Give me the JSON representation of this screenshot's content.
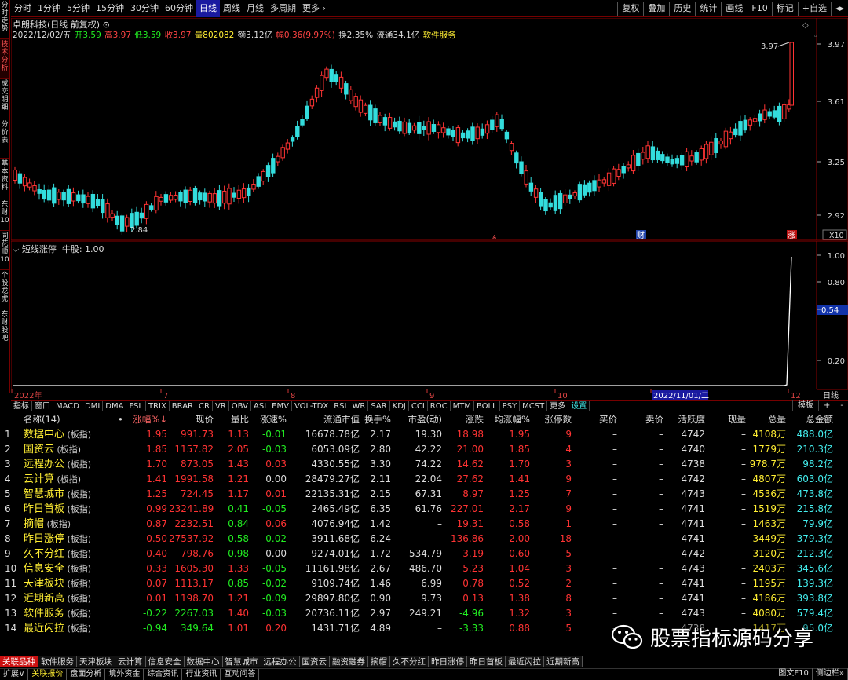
{
  "left_tabs": [
    "分时走势",
    "技术分析",
    "成交明细",
    "分价表",
    "基本资料",
    "东财10",
    "同花顺10",
    "个股龙虎",
    "东财股吧"
  ],
  "left_tab_active": 1,
  "periods": [
    "分时",
    "1分钟",
    "5分钟",
    "15分钟",
    "30分钟",
    "60分钟",
    "日线",
    "周线",
    "月线",
    "多周期",
    "更多 ›"
  ],
  "period_active": 6,
  "right_buttons": [
    "复权",
    "叠加",
    "历史",
    "统计",
    "画线",
    "F10",
    "标记",
    "+自选",
    "◂▸"
  ],
  "info_title": "卓朗科技(日线 前复权) ⊙",
  "info_fields": [
    {
      "text": "2022/12/02/五",
      "cls": "w"
    },
    {
      "text": "开3.59",
      "cls": "g"
    },
    {
      "text": "高3.97",
      "cls": "r"
    },
    {
      "text": "低3.59",
      "cls": "g"
    },
    {
      "text": "收3.97",
      "cls": "r"
    },
    {
      "text": "量802082",
      "cls": "y"
    },
    {
      "text": "额3.12亿",
      "cls": "w"
    },
    {
      "text": "幅0.36(9.97%)",
      "cls": "r"
    },
    {
      "text": "换2.35%",
      "cls": "w"
    },
    {
      "text": "流通34.1亿",
      "cls": "w"
    },
    {
      "text": "软件服务",
      "cls": "y"
    }
  ],
  "main_axis_labels": [
    "3.97",
    "3.61",
    "3.25",
    "2.92"
  ],
  "hi_label": "3.97",
  "lo_label": "2.84",
  "x10_label": "X10",
  "markers": {
    "cai": "财",
    "zhang": "涨"
  },
  "indicator_info": {
    "name": "短线涨停",
    "value": "牛股: 1.00"
  },
  "ind_axis_labels": [
    "1.00",
    "0.80",
    "0.54",
    "0.20"
  ],
  "date_labels": [
    "2022年",
    "7",
    "8",
    "9",
    "10",
    "2022/11/01/二",
    "12"
  ],
  "period_short": "日线",
  "indicator_tabs": [
    "指标",
    "窗口",
    "MACD",
    "DMI",
    "DMA",
    "FSL",
    "TRIX",
    "BRAR",
    "CR",
    "VR",
    "OBV",
    "ASI",
    "EMV",
    "VOL-TDX",
    "RSI",
    "WR",
    "SAR",
    "KDJ",
    "CCI",
    "ROC",
    "MTM",
    "BOLL",
    "PSY",
    "MCST",
    "更多",
    "设置"
  ],
  "indicator_tabs_right": [
    "模板",
    "+",
    "-"
  ],
  "table_header": [
    "名称(14)",
    "•",
    "涨幅%↓",
    "现价",
    "量比",
    "涨速%",
    "流通市值",
    "换手%",
    "市盈(动)",
    "涨跌",
    "均涨幅%",
    "涨停数",
    "买价",
    "卖价",
    "活跃度",
    "现量",
    "总量",
    "总金额"
  ],
  "table_rows": [
    {
      "i": "1",
      "name": "数据中心",
      "tag": "(板指)",
      "chg": "1.95",
      "price": "991.73",
      "vr": "1.13",
      "spd": "-0.01",
      "mcap": "16678.78亿",
      "turn": "2.17",
      "pe": "19.30",
      "diff": "18.98",
      "avg": "1.95",
      "lim": "9",
      "bid": "–",
      "ask": "–",
      "act": "4742",
      "cur": "–",
      "vol": "4108万",
      "amt": "488.0亿"
    },
    {
      "i": "2",
      "name": "国资云",
      "tag": "(板指)",
      "chg": "1.85",
      "price": "1157.82",
      "vr": "2.05",
      "spd": "-0.03",
      "mcap": "6053.09亿",
      "turn": "2.80",
      "pe": "42.22",
      "diff": "21.00",
      "avg": "1.85",
      "lim": "4",
      "bid": "–",
      "ask": "–",
      "act": "4740",
      "cur": "–",
      "vol": "1779万",
      "amt": "210.3亿"
    },
    {
      "i": "3",
      "name": "远程办公",
      "tag": "(板指)",
      "chg": "1.70",
      "price": "873.05",
      "vr": "1.43",
      "spd": "0.03",
      "mcap": "4330.55亿",
      "turn": "3.30",
      "pe": "74.22",
      "diff": "14.62",
      "avg": "1.70",
      "lim": "3",
      "bid": "–",
      "ask": "–",
      "act": "4738",
      "cur": "–",
      "vol": "978.7万",
      "amt": "98.2亿"
    },
    {
      "i": "4",
      "name": "云计算",
      "tag": "(板指)",
      "chg": "1.41",
      "price": "1991.58",
      "vr": "1.21",
      "spd": "0.00",
      "mcap": "28479.27亿",
      "turn": "2.11",
      "pe": "22.04",
      "diff": "27.62",
      "avg": "1.41",
      "lim": "9",
      "bid": "–",
      "ask": "–",
      "act": "4742",
      "cur": "–",
      "vol": "4807万",
      "amt": "603.0亿"
    },
    {
      "i": "5",
      "name": "智慧城市",
      "tag": "(板指)",
      "chg": "1.25",
      "price": "724.45",
      "vr": "1.17",
      "spd": "0.01",
      "mcap": "22135.31亿",
      "turn": "2.15",
      "pe": "67.31",
      "diff": "8.97",
      "avg": "1.25",
      "lim": "7",
      "bid": "–",
      "ask": "–",
      "act": "4743",
      "cur": "–",
      "vol": "4536万",
      "amt": "473.8亿"
    },
    {
      "i": "6",
      "name": "昨日首板",
      "tag": "(板指)",
      "chg": "0.99",
      "price": "23241.89",
      "vr": "0.41",
      "spd": "-0.05",
      "mcap": "2465.49亿",
      "turn": "6.35",
      "pe": "61.76",
      "diff": "227.01",
      "avg": "2.17",
      "lim": "9",
      "bid": "–",
      "ask": "–",
      "act": "4741",
      "cur": "–",
      "vol": "1519万",
      "amt": "215.8亿"
    },
    {
      "i": "7",
      "name": "摘帽",
      "tag": "(板指)",
      "chg": "0.87",
      "price": "2232.51",
      "vr": "0.84",
      "spd": "0.06",
      "mcap": "4076.94亿",
      "turn": "1.42",
      "pe": "–",
      "diff": "19.31",
      "avg": "0.58",
      "lim": "1",
      "bid": "–",
      "ask": "–",
      "act": "4741",
      "cur": "–",
      "vol": "1463万",
      "amt": "79.9亿"
    },
    {
      "i": "8",
      "name": "昨日涨停",
      "tag": "(板指)",
      "chg": "0.50",
      "price": "27537.92",
      "vr": "0.58",
      "spd": "-0.02",
      "mcap": "3911.68亿",
      "turn": "6.24",
      "pe": "–",
      "diff": "136.86",
      "avg": "2.00",
      "lim": "18",
      "bid": "–",
      "ask": "–",
      "act": "4741",
      "cur": "–",
      "vol": "3449万",
      "amt": "379.3亿"
    },
    {
      "i": "9",
      "name": "久不分红",
      "tag": "(板指)",
      "chg": "0.40",
      "price": "798.76",
      "vr": "0.98",
      "spd": "0.00",
      "mcap": "9274.01亿",
      "turn": "1.72",
      "pe": "534.79",
      "diff": "3.19",
      "avg": "0.60",
      "lim": "5",
      "bid": "–",
      "ask": "–",
      "act": "4742",
      "cur": "–",
      "vol": "3120万",
      "amt": "212.3亿"
    },
    {
      "i": "10",
      "name": "信息安全",
      "tag": "(板指)",
      "chg": "0.33",
      "price": "1605.30",
      "vr": "1.33",
      "spd": "-0.05",
      "mcap": "11161.98亿",
      "turn": "2.67",
      "pe": "486.70",
      "diff": "5.23",
      "avg": "1.04",
      "lim": "3",
      "bid": "–",
      "ask": "–",
      "act": "4743",
      "cur": "–",
      "vol": "2403万",
      "amt": "345.6亿"
    },
    {
      "i": "11",
      "name": "天津板块",
      "tag": "(板指)",
      "chg": "0.07",
      "price": "1113.17",
      "vr": "0.85",
      "spd": "-0.02",
      "mcap": "9109.74亿",
      "turn": "1.46",
      "pe": "6.99",
      "diff": "0.78",
      "avg": "0.52",
      "lim": "2",
      "bid": "–",
      "ask": "–",
      "act": "4741",
      "cur": "–",
      "vol": "1195万",
      "amt": "139.3亿"
    },
    {
      "i": "12",
      "name": "近期新高",
      "tag": "(板指)",
      "chg": "0.01",
      "price": "1198.70",
      "vr": "1.21",
      "spd": "-0.09",
      "mcap": "29897.80亿",
      "turn": "0.90",
      "pe": "9.73",
      "diff": "0.13",
      "avg": "1.38",
      "lim": "8",
      "bid": "–",
      "ask": "–",
      "act": "4741",
      "cur": "–",
      "vol": "4186万",
      "amt": "393.8亿"
    },
    {
      "i": "13",
      "name": "软件服务",
      "tag": "(板指)",
      "chg": "-0.22",
      "price": "2267.03",
      "vr": "1.40",
      "spd": "-0.03",
      "mcap": "20736.11亿",
      "turn": "2.97",
      "pe": "249.21",
      "diff": "-4.96",
      "avg": "1.32",
      "lim": "3",
      "bid": "–",
      "ask": "–",
      "act": "4743",
      "cur": "–",
      "vol": "4080万",
      "amt": "579.4亿"
    },
    {
      "i": "14",
      "name": "最近闪拉",
      "tag": "(板指)",
      "chg": "-0.94",
      "price": "349.64",
      "vr": "1.01",
      "spd": "0.20",
      "mcap": "1431.71亿",
      "turn": "4.89",
      "pe": "–",
      "diff": "-3.33",
      "avg": "0.88",
      "lim": "5",
      "bid": "–",
      "ask": "–",
      "act": "4738",
      "cur": "–",
      "vol": "1417万",
      "amt": "95.0亿"
    }
  ],
  "bottom_tabs1": [
    "关联品种",
    "软件服务",
    "天津板块",
    "云计算",
    "信息安全",
    "数据中心",
    "智慧城市",
    "远程办公",
    "国资云",
    "融资融券",
    "摘帽",
    "久不分红",
    "昨日涨停",
    "昨日首板",
    "最近闪拉",
    "近期新高"
  ],
  "bottom_tabs2": [
    "扩展∨",
    "关联报价",
    "盘面分析",
    "境外资金",
    "综合资讯",
    "行业资讯",
    "互动问答"
  ],
  "bottom_right": [
    "图文F10",
    "侧边栏»"
  ],
  "watermark": "股票指标源码分享",
  "colors": {
    "up": "#ff3333",
    "down": "#33dddd",
    "bg": "#000000",
    "grid": "#700000",
    "name": "#ffee33"
  }
}
